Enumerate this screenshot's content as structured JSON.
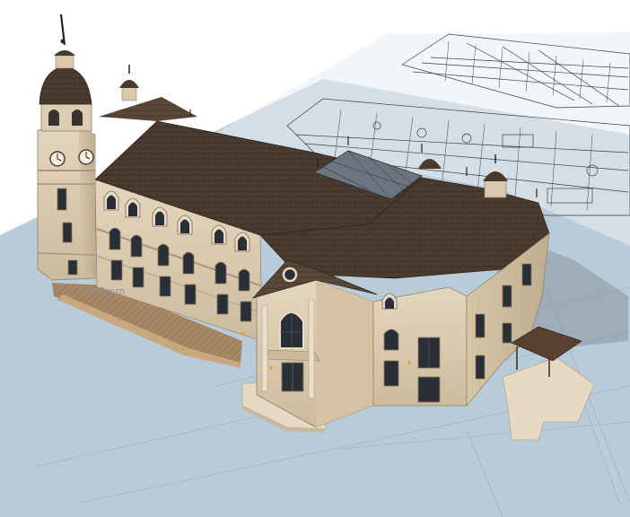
{
  "scene": {
    "dimension_label": "15.0mm"
  }
}
